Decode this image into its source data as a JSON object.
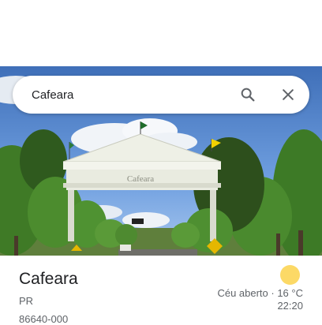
{
  "search": {
    "value": "Cafeara",
    "search_icon": "search-icon",
    "close_icon": "close-icon"
  },
  "hero": {
    "arch_sign": "Cafeara"
  },
  "place": {
    "name": "Cafeara",
    "region": "PR",
    "postal_code": "86640-000"
  },
  "weather": {
    "icon": "sun-icon",
    "condition": "Céu aberto · 16 °C",
    "local_time": "22:20"
  },
  "colors": {
    "sun": "#fcd966",
    "text_primary": "#202124",
    "text_secondary": "#5f6368"
  }
}
